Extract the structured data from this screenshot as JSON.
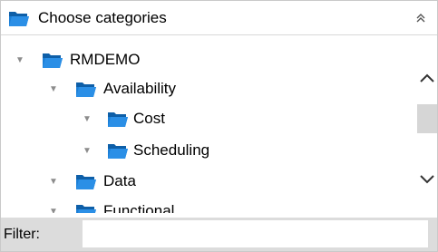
{
  "header": {
    "title": "Choose categories",
    "folder_icon": "folder-open-icon",
    "collapse_icon": "double-chevron-up-icon"
  },
  "tree": {
    "nodes": [
      {
        "label": "RMDEMO",
        "depth": 0,
        "expanded": true
      },
      {
        "label": "Availability",
        "depth": 1,
        "expanded": true
      },
      {
        "label": "Cost",
        "depth": 2,
        "expanded": true
      },
      {
        "label": "Scheduling",
        "depth": 2,
        "expanded": true
      },
      {
        "label": "Data",
        "depth": 1,
        "expanded": true
      },
      {
        "label": "Functional",
        "depth": 1,
        "expanded": true
      }
    ]
  },
  "filter": {
    "label": "Filter:",
    "value": "",
    "placeholder": ""
  },
  "colors": {
    "folder_blue": "#1c7fd6",
    "folder_blue_dark": "#0e5fa8",
    "filter_bar": "#dcdcdc",
    "scroll_thumb": "#d6d6d6"
  }
}
